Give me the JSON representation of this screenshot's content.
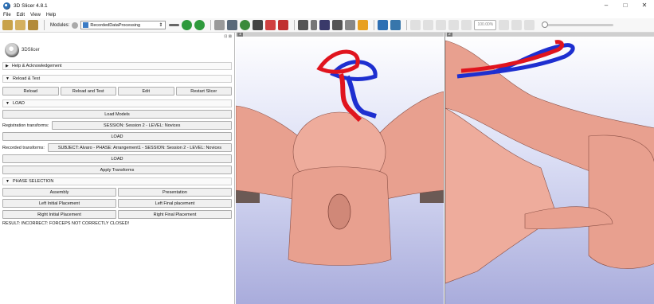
{
  "window": {
    "title": "3D Slicer 4.8.1",
    "min": "–",
    "max": "□",
    "close": "✕"
  },
  "menu": [
    "File",
    "Edit",
    "View",
    "Help"
  ],
  "toolbar": {
    "modules_label": "Modules:",
    "module_selected": "RecordedDataProcessing",
    "zoom": "100.00%"
  },
  "panel": {
    "logo_text": "3DSlicer",
    "dock_controls": "⊡ ⊠",
    "sections": {
      "help": "Help & Acknowledgement",
      "reload": "Reload & Test",
      "load": "LOAD",
      "phase": "PHASE SELECTION"
    },
    "reload_buttons": [
      "Reload",
      "Reload and Test",
      "Edit",
      "Restart Slicer"
    ],
    "load_models": "Load Models",
    "registration_label": "Registration transforms:",
    "registration_value": "SESSION: Session 2 - LEVEL: Novices",
    "load_btn": "LOAD",
    "recorded_label": "Recorded transforms:",
    "recorded_value": "SUBJECT: Alvaro - PHASE: Arrangement1 - SESSION: Session 2 - LEVEL: Novices",
    "apply": "Apply Transforms",
    "phase_buttons": [
      [
        "Assembly",
        "Presentation"
      ],
      [
        "Left Initial Placement",
        "Left Final placement"
      ],
      [
        "Right Initial Placement",
        "Right Final Placement"
      ]
    ],
    "result": "RESULT: INCORRECT: FORCEPS NOT CORRECTLY CLOSED!"
  },
  "views": {
    "view1_label": "1",
    "view2_label": "2"
  },
  "colors": {
    "skin": "#e8a08f",
    "forceps_red": "#e0141e",
    "forceps_blue": "#1e2fd0",
    "bg_top": "#ffffff",
    "bg_bottom": "#a9acdc"
  }
}
